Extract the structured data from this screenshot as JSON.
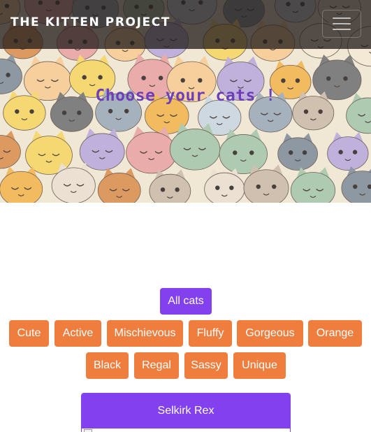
{
  "navbar": {
    "brand": "THE KITTEN PROJECT",
    "toggler_icon": "hamburger-menu-icon"
  },
  "hero": {
    "title": "Choose your cats !",
    "background": "illustrated cat pattern"
  },
  "filters": {
    "active": "All cats",
    "all_label": "All cats",
    "categories": [
      "Cute",
      "Active",
      "Mischievous",
      "Fluffy",
      "Gorgeous",
      "Orange",
      "Black",
      "Regal",
      "Sassy",
      "Unique"
    ]
  },
  "card": {
    "title": "Selkirk Rex",
    "image_icon": "broken-image-icon"
  },
  "colors": {
    "accent_purple": "#8240ee",
    "button_orange": "#ef7e3e",
    "title_purple": "#6c3fb8",
    "navbar_dark": "#26201e"
  }
}
